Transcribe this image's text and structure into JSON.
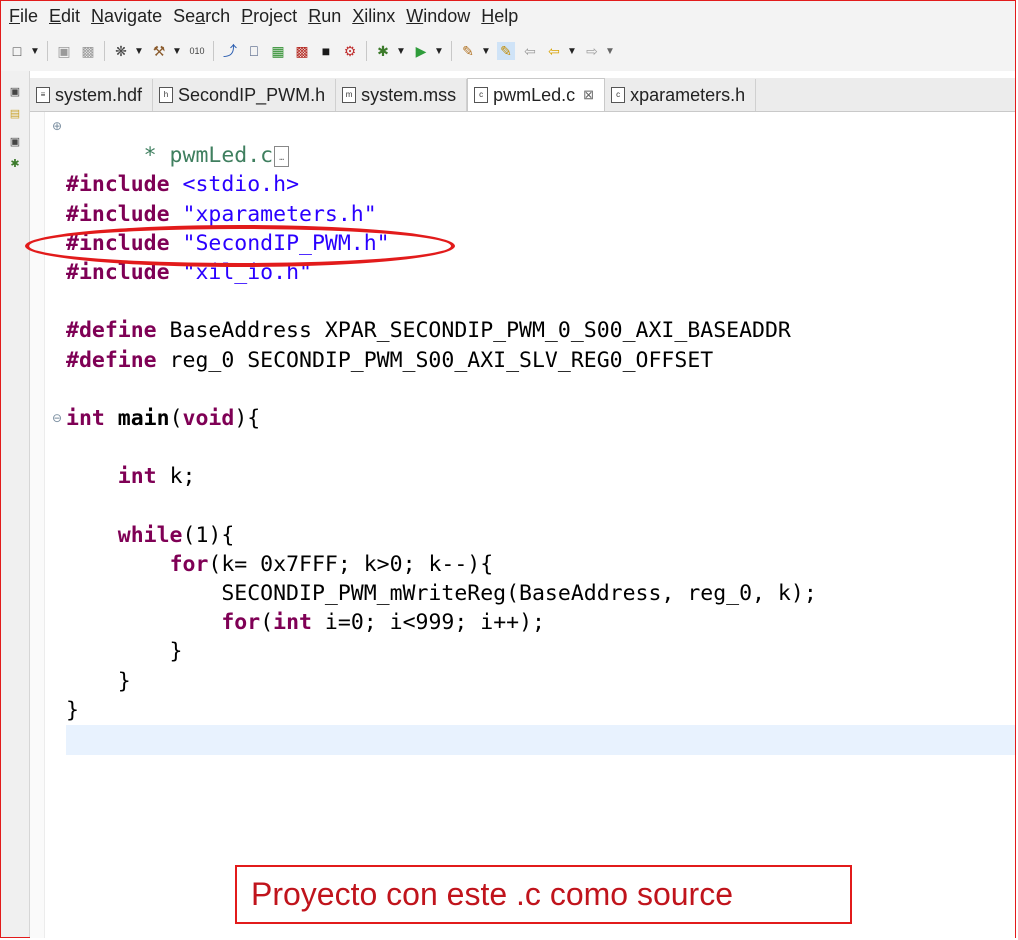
{
  "menu": {
    "items": [
      {
        "mnemonic": "F",
        "rest": "ile"
      },
      {
        "mnemonic": "E",
        "rest": "dit"
      },
      {
        "mnemonic": "N",
        "rest": "avigate"
      },
      {
        "pre": "Se",
        "mnemonic": "a",
        "rest": "rch"
      },
      {
        "mnemonic": "P",
        "rest": "roject"
      },
      {
        "mnemonic": "R",
        "rest": "un"
      },
      {
        "mnemonic": "X",
        "rest": "ilinx"
      },
      {
        "mnemonic": "W",
        "rest": "indow"
      },
      {
        "mnemonic": "H",
        "rest": "elp"
      }
    ]
  },
  "tabs": [
    {
      "label": "system.hdf",
      "icon": "hdf-file-icon",
      "active": false
    },
    {
      "label": "SecondIP_PWM.h",
      "icon": "header-file-icon",
      "active": false
    },
    {
      "label": "system.mss",
      "icon": "mss-file-icon",
      "active": false
    },
    {
      "label": "pwmLed.c",
      "icon": "c-file-icon",
      "active": true,
      "close": "⊠"
    },
    {
      "label": "xparameters.h",
      "icon": "c-file-icon",
      "active": false
    }
  ],
  "code": {
    "header_comment": "* pwmLed.c",
    "lines": [
      [
        [
          "kw",
          "#include"
        ],
        [
          "t",
          " "
        ],
        [
          "str",
          "<stdio.h>"
        ]
      ],
      [
        [
          "kw",
          "#include"
        ],
        [
          "t",
          " "
        ],
        [
          "str",
          "\"xparameters.h\""
        ]
      ],
      [
        [
          "kw",
          "#include"
        ],
        [
          "t",
          " "
        ],
        [
          "str",
          "\"SecondIP_PWM.h\""
        ]
      ],
      [
        [
          "kw",
          "#include"
        ],
        [
          "t",
          " "
        ],
        [
          "str",
          "\"xil_io.h\""
        ]
      ],
      [],
      [
        [
          "kw",
          "#define"
        ],
        [
          "t",
          " BaseAddress XPAR_SECONDIP_PWM_0_S00_AXI_BASEADDR"
        ]
      ],
      [
        [
          "kw",
          "#define"
        ],
        [
          "t",
          " reg_0 SECONDIP_PWM_S00_AXI_SLV_REG0_OFFSET"
        ]
      ],
      [],
      [
        [
          "kw",
          "int"
        ],
        [
          "t",
          " "
        ],
        [
          "b",
          "main"
        ],
        [
          "t",
          "("
        ],
        [
          "kw",
          "void"
        ],
        [
          "t",
          "){"
        ]
      ],
      [],
      [
        [
          "t",
          "    "
        ],
        [
          "kw",
          "int"
        ],
        [
          "t",
          " k;"
        ]
      ],
      [],
      [
        [
          "t",
          "    "
        ],
        [
          "kw",
          "while"
        ],
        [
          "t",
          "(1){"
        ]
      ],
      [
        [
          "t",
          "        "
        ],
        [
          "kw",
          "for"
        ],
        [
          "t",
          "(k= 0x7FFF; k>0; k--){"
        ]
      ],
      [
        [
          "t",
          "            SECONDIP_PWM_mWriteReg(BaseAddress, reg_0, k);"
        ]
      ],
      [
        [
          "t",
          "            "
        ],
        [
          "kw",
          "for"
        ],
        [
          "t",
          "("
        ],
        [
          "kw",
          "int"
        ],
        [
          "t",
          " i=0; i<999; i++);"
        ]
      ],
      [
        [
          "t",
          "        }"
        ]
      ],
      [
        [
          "t",
          "    }"
        ]
      ],
      [
        [
          "t",
          "}"
        ]
      ],
      []
    ]
  },
  "annotation": {
    "note": "Proyecto con este .c como source"
  },
  "colors": {
    "keyword": "#7f0055",
    "string": "#2a00ff",
    "comment": "#3f7f5f",
    "annotation": "#e21b1b"
  }
}
